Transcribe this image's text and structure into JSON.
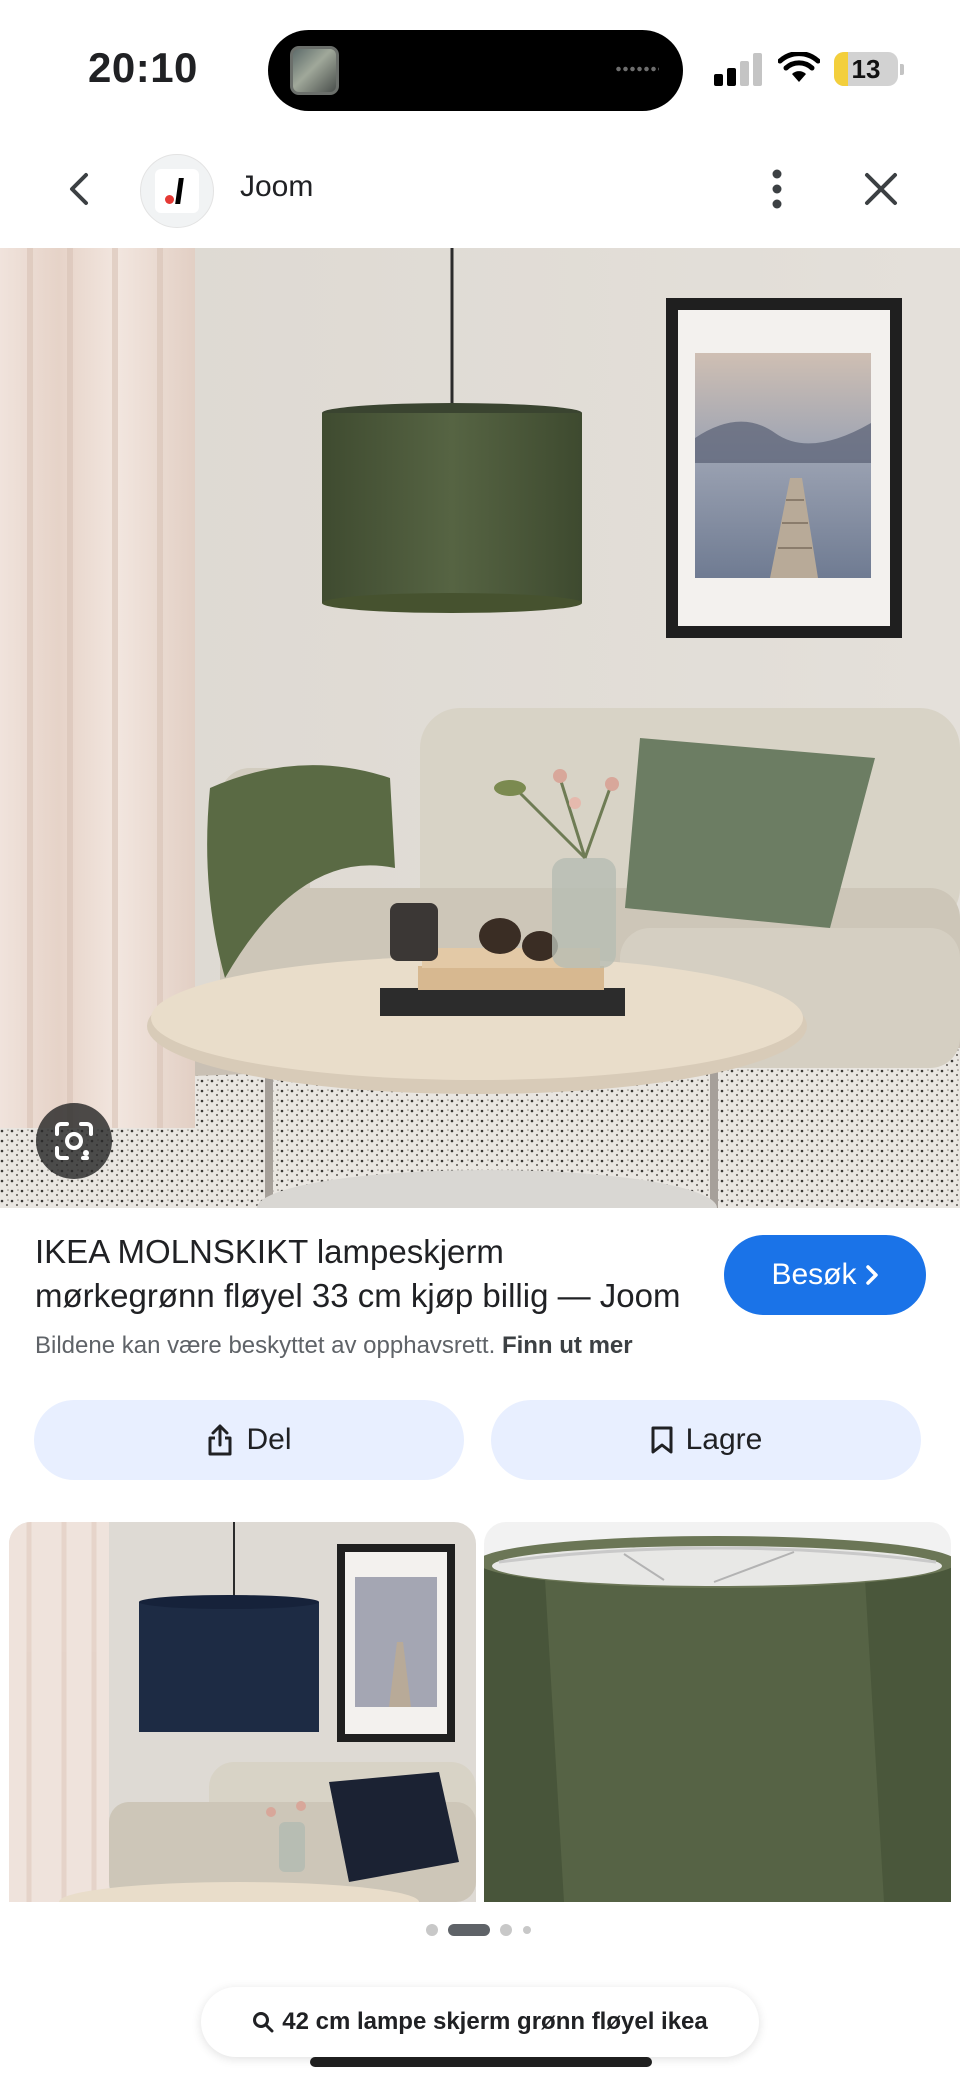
{
  "status_bar": {
    "time": "20:10",
    "battery_level": "13",
    "signal_bars_active": 2,
    "signal_bars_total": 4
  },
  "header": {
    "site_name": "Joom",
    "back_icon": "chevron-left-icon",
    "more_icon": "more-vert-icon",
    "close_icon": "close-icon"
  },
  "result": {
    "title": "IKEA MOLNSKIKT lampeskjerm mørkegrønn fløyel 33 cm kjøp billig — Joom",
    "visit_label": "Besøk",
    "copyright_text": "Bildene kan være beskyttet av opphavsrett.",
    "copyright_link": "Finn ut mer"
  },
  "actions": {
    "share_label": "Del",
    "save_label": "Lagre"
  },
  "pager": {
    "active_index": 1,
    "count": 4
  },
  "search": {
    "query": "42 cm lampe skjerm grønn fløyel ikea"
  },
  "colors": {
    "accent": "#1a73e8",
    "action_bg": "#e8efff",
    "battery_low": "#f3cf3c",
    "lampshade_green": "#4f5e3c",
    "lampshade_blue": "#1d2b44"
  }
}
